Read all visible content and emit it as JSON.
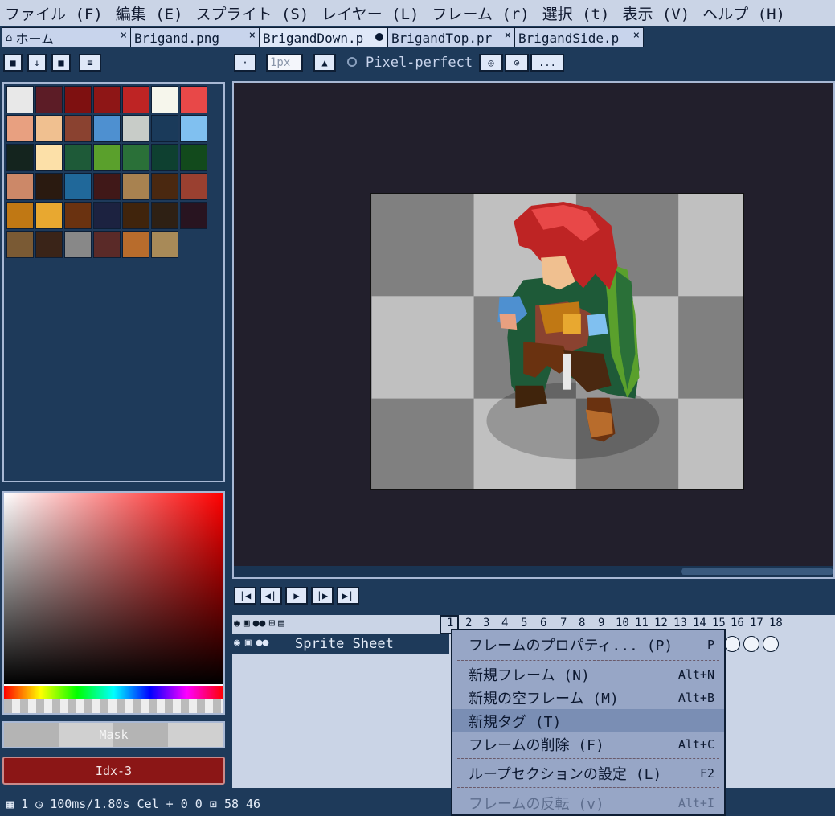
{
  "menu": [
    "ファイル (F)",
    "編集 (E)",
    "スプライト (S)",
    "レイヤー (L)",
    "フレーム (r)",
    "選択 (t)",
    "表示 (V)",
    "ヘルプ (H)"
  ],
  "tabs": [
    {
      "label": "ホーム",
      "close": "×"
    },
    {
      "label": "Brigand.png",
      "close": "×"
    },
    {
      "label": "BrigandDown.p",
      "close": ""
    },
    {
      "label": "BrigandTop.pr",
      "close": "×"
    },
    {
      "label": "BrigandSide.p",
      "close": "×"
    }
  ],
  "toolbar": {
    "brush_size": "1px",
    "pixel_perfect": "Pixel-perfect",
    "more": "..."
  },
  "palette": [
    "#e8e8e8",
    "#5c1c26",
    "#7e1010",
    "#8e1616",
    "#be2424",
    "#f6f6ec",
    "#e84848",
    "#e8a080",
    "#f0c090",
    "#8a4230",
    "#4e90d0",
    "#c8ccc8",
    "#1a3a5a",
    "#80c0f0",
    "#14241e",
    "#fce0a8",
    "#1e5a38",
    "#5aa02c",
    "#2a7038",
    "#0e4030",
    "#124a1c",
    "#cc8868",
    "#2a1a10",
    "#20689a",
    "#401818",
    "#a88250",
    "#4a2810",
    "#9a4030",
    "#c07814",
    "#e8a830",
    "#6a3210",
    "#1c2240",
    "#40240c",
    "#2e2014",
    "#281420",
    "#7a5a34",
    "#3a2418",
    "#888888",
    "#5a2a28",
    "#b86c2c",
    "#a88a58"
  ],
  "picker": {
    "mask": "Mask",
    "index": "Idx-3"
  },
  "timeline": {
    "layer_name": "Sprite Sheet",
    "frames": [
      "1",
      "2",
      "3",
      "4",
      "5",
      "6",
      "7",
      "8",
      "9",
      "10",
      "11",
      "12",
      "13",
      "14",
      "15",
      "16",
      "17",
      "18"
    ]
  },
  "context_menu": [
    {
      "label": "フレームのプロパティ... (P)",
      "shortcut": "P"
    },
    {
      "label": "新規フレーム (N)",
      "shortcut": "Alt+N"
    },
    {
      "label": "新規の空フレーム (M)",
      "shortcut": "Alt+B"
    },
    {
      "label": "新規タグ (T)",
      "shortcut": ""
    },
    {
      "label": "フレームの削除 (F)",
      "shortcut": "Alt+C"
    },
    {
      "label": "ループセクションの設定 (L)",
      "shortcut": "F2"
    },
    {
      "label": "フレームの反転 (v)",
      "shortcut": "Alt+I"
    }
  ],
  "status": {
    "frame": "1",
    "duration": "100ms/1.80s",
    "cel": "Cel",
    "pos": "0 0",
    "size": "58 46"
  },
  "colors": {
    "accent": "#8b1616",
    "menubg": "#cad4e6",
    "bg": "#1e3a5a"
  }
}
